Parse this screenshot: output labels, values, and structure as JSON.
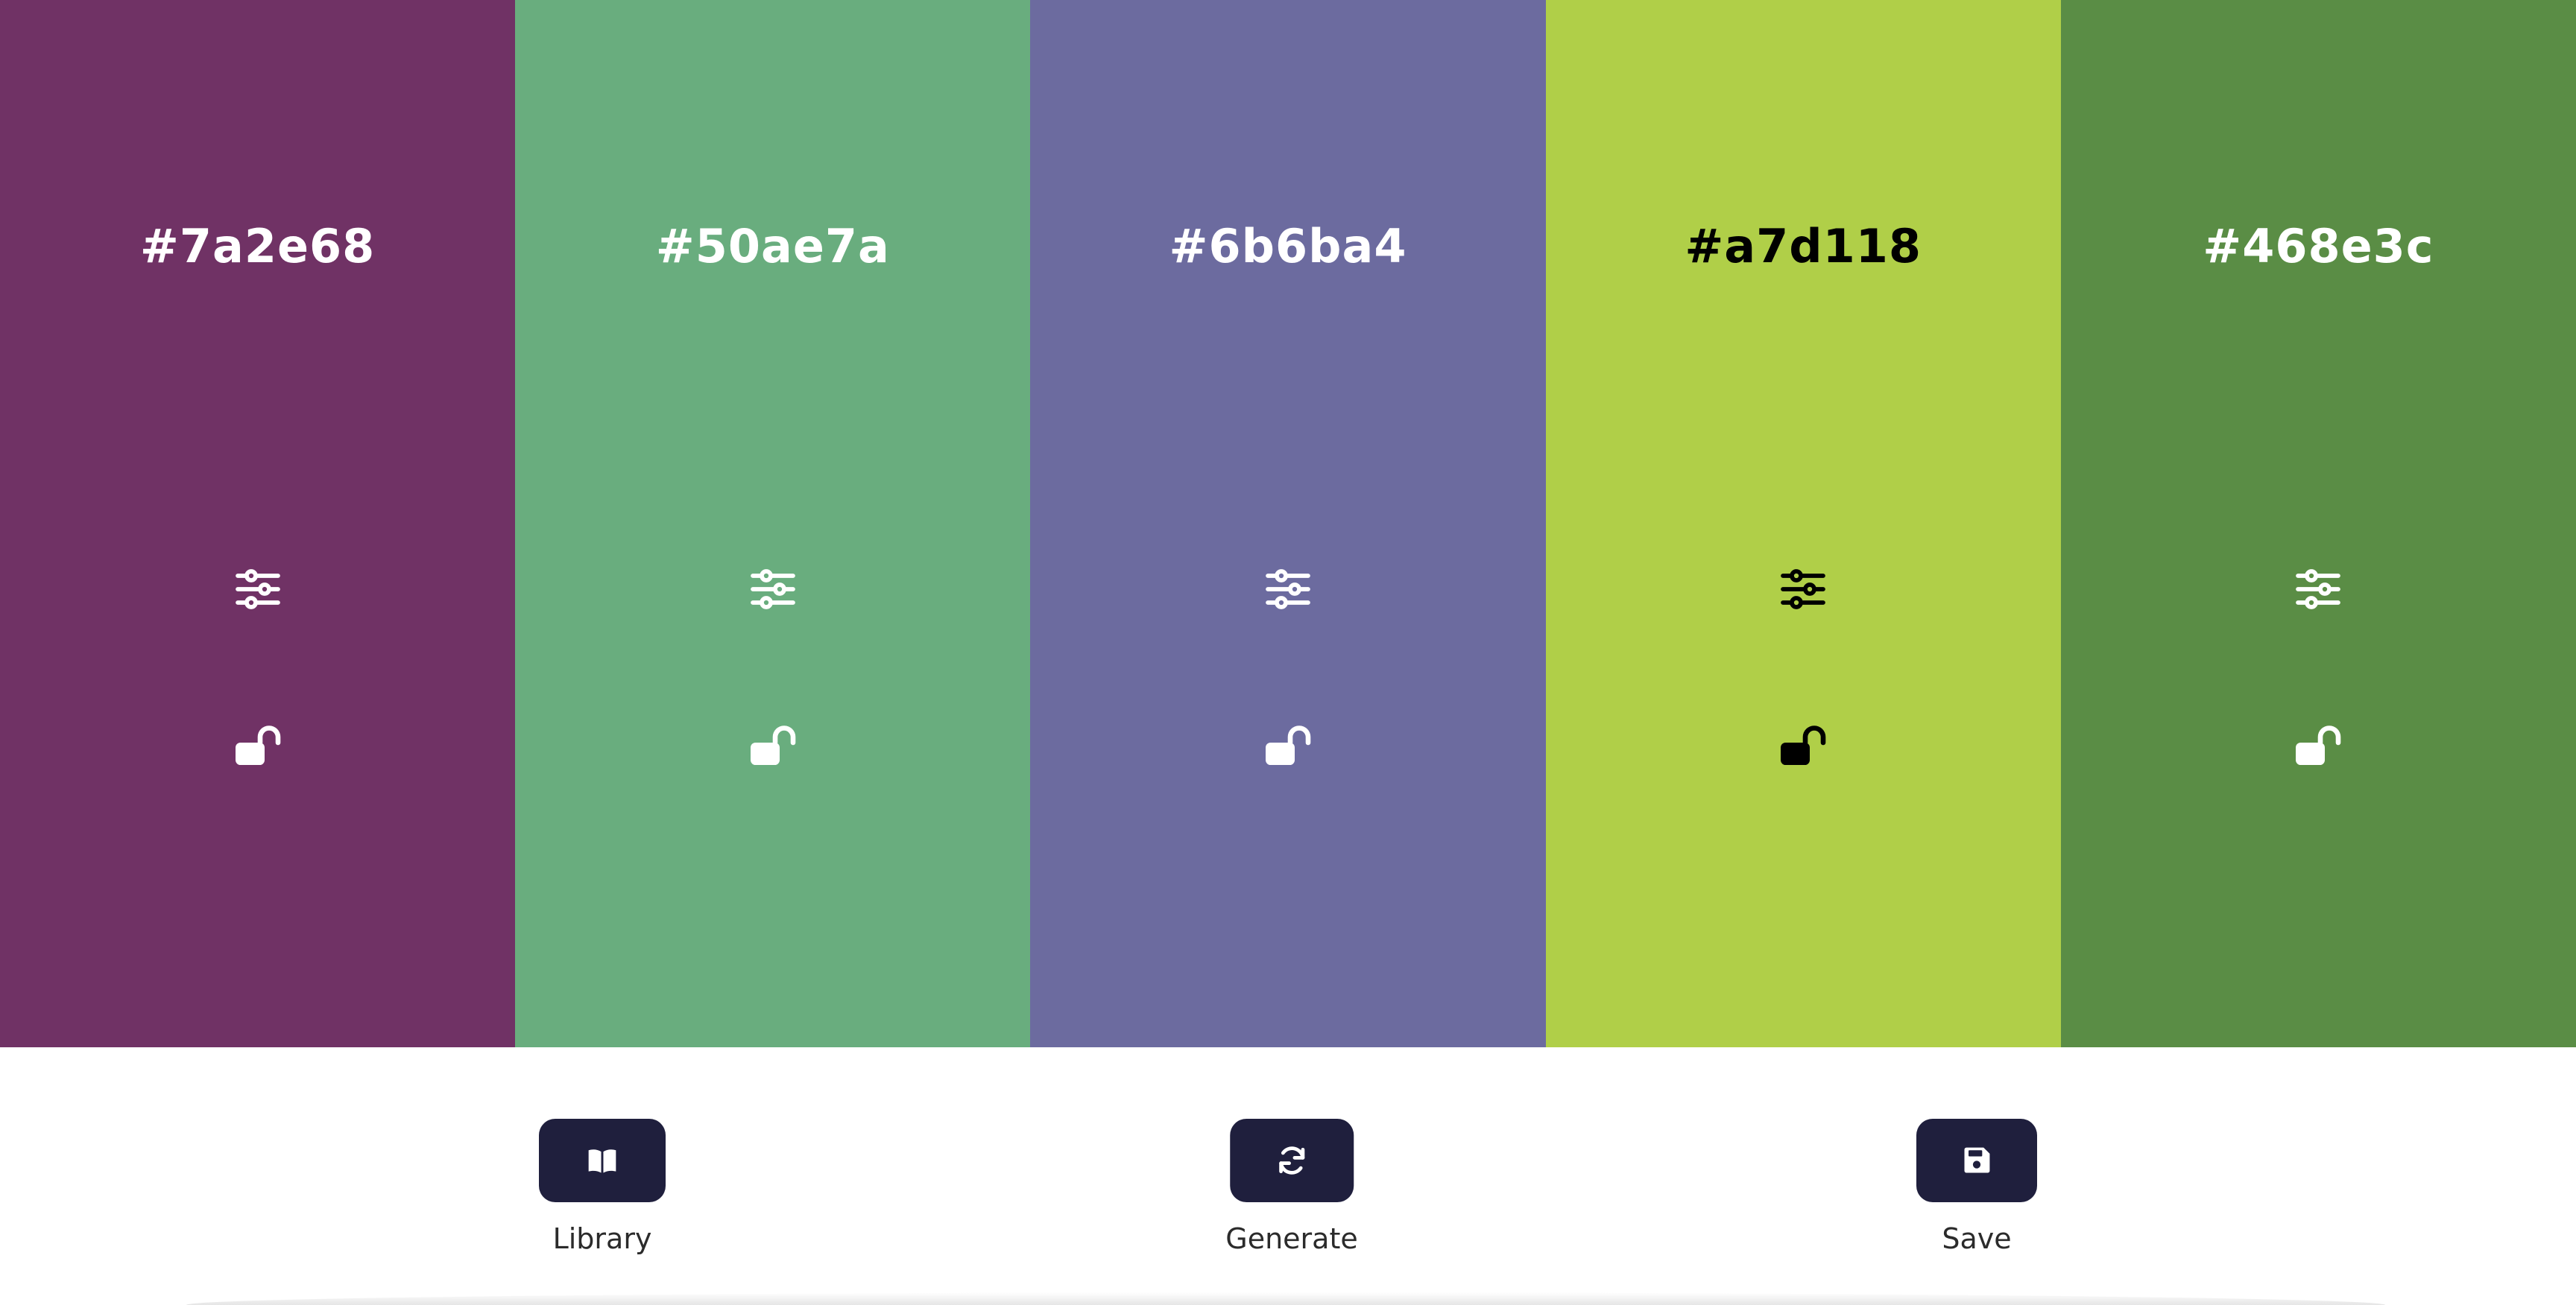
{
  "palette": [
    {
      "hex": "#7a2e68",
      "bg": "#703265",
      "text_color": "#ffffff"
    },
    {
      "hex": "#50ae7a",
      "bg": "#69ad7e",
      "text_color": "#ffffff"
    },
    {
      "hex": "#6b6ba4",
      "bg": "#6c6b9f",
      "text_color": "#ffffff"
    },
    {
      "hex": "#a7d118",
      "bg": "#b0cf48",
      "text_color": "#000000"
    },
    {
      "hex": "#468e3c",
      "bg": "#5a8d45",
      "text_color": "#ffffff"
    }
  ],
  "icons": {
    "adjust": "sliders-icon",
    "lock": "unlocked-padlock-icon"
  },
  "controls": {
    "library": {
      "label": "Library",
      "icon": "book-icon"
    },
    "generate": {
      "label": "Generate",
      "icon": "refresh-icon"
    },
    "save": {
      "label": "Save",
      "icon": "floppy-disk-icon"
    }
  },
  "theme": {
    "button_bg": "#1f1f3d",
    "panel_bg": "#ffffff"
  }
}
